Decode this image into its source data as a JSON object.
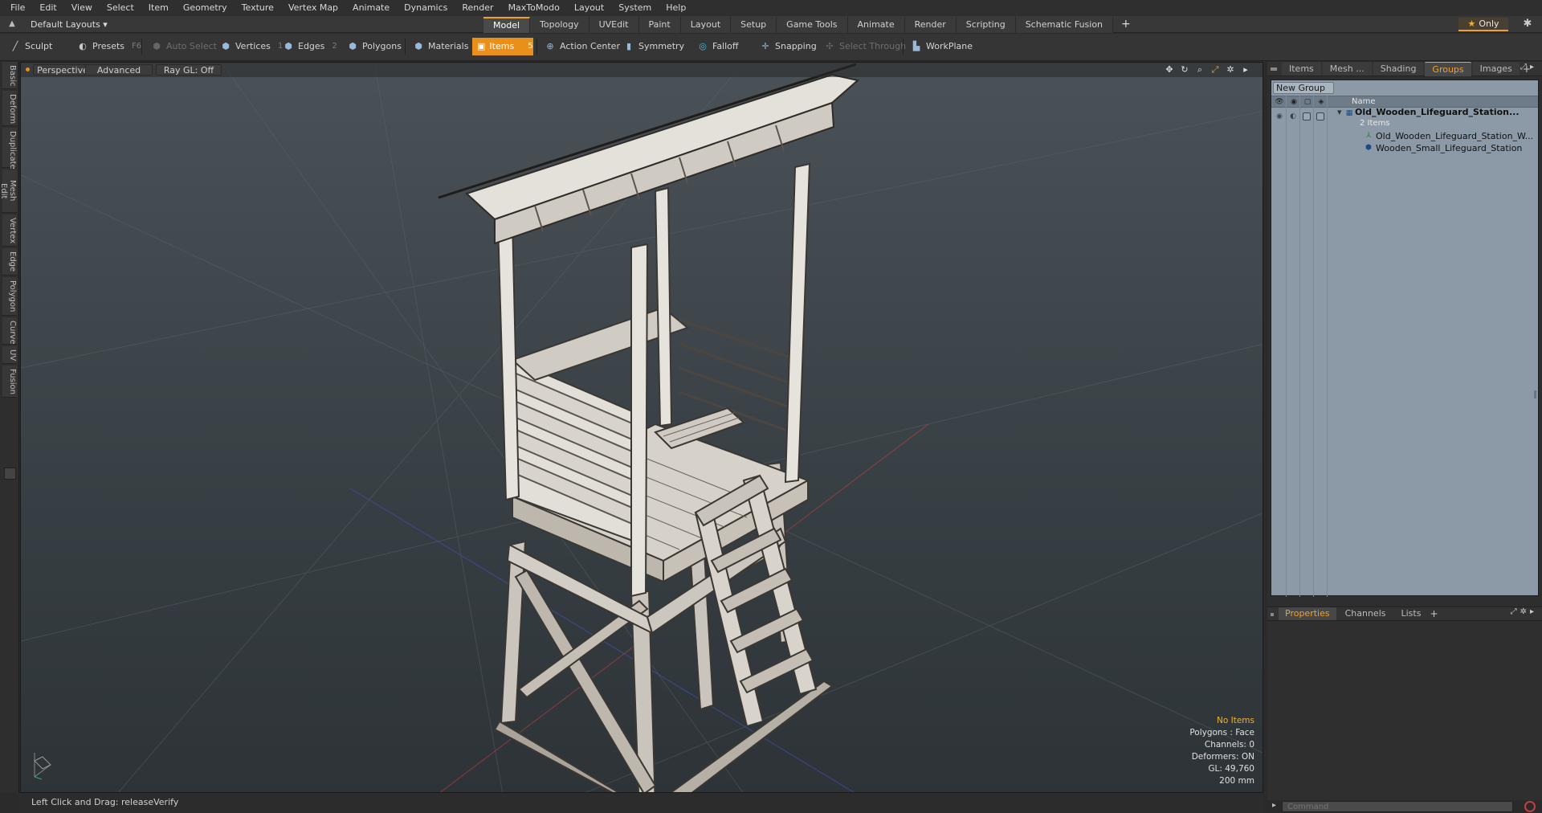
{
  "menubar": [
    "File",
    "Edit",
    "View",
    "Select",
    "Item",
    "Geometry",
    "Texture",
    "Vertex Map",
    "Animate",
    "Dynamics",
    "Render",
    "MaxToModo",
    "Layout",
    "System",
    "Help"
  ],
  "layoutbar": {
    "layouts_label": "Default Layouts ▾",
    "tabs": [
      {
        "label": "Model",
        "active": true
      },
      {
        "label": "Topology",
        "active": false
      },
      {
        "label": "UVEdit",
        "active": false
      },
      {
        "label": "Paint",
        "active": false
      },
      {
        "label": "Layout",
        "active": false
      },
      {
        "label": "Setup",
        "active": false
      },
      {
        "label": "Game Tools",
        "active": false
      },
      {
        "label": "Animate",
        "active": false
      },
      {
        "label": "Render",
        "active": false
      },
      {
        "label": "Scripting",
        "active": false
      },
      {
        "label": "Schematic Fusion",
        "active": false
      }
    ],
    "add_tab": "+",
    "only_label": "Only",
    "only_star": "★",
    "gear": "✱"
  },
  "toolbar": {
    "sculpt": "Sculpt",
    "presets": "Presets",
    "presets_key": "F6",
    "auto_select": "Auto Select",
    "vertices": "Vertices",
    "vertices_key": "1",
    "edges": "Edges",
    "edges_key": "2",
    "polygons": "Polygons",
    "materials": "Materials",
    "items": "Items",
    "items_key": "5",
    "action_center": "Action Center",
    "symmetry": "Symmetry",
    "falloff": "Falloff",
    "snapping": "Snapping",
    "select_through": "Select Through",
    "workplane": "WorkPlane"
  },
  "lefttabs": [
    "Basic",
    "Deform",
    "Duplicate",
    "Mesh Edit",
    "Vertex",
    "Edge",
    "Polygon",
    "Curve",
    "UV",
    "Fusion"
  ],
  "viewport": {
    "perspective": "Perspective",
    "advanced": "Advanced",
    "raygl": "Ray GL: Off",
    "info": {
      "no_items": "No Items",
      "polygons": "Polygons : Face",
      "channels": "Channels: 0",
      "deformers": "Deformers: ON",
      "gl": "GL: 49,760",
      "scale": "200 mm"
    }
  },
  "status": "Left Click and Drag:   releaseVerify",
  "rightpanel": {
    "tabs": [
      {
        "label": "Items",
        "active": false
      },
      {
        "label": "Mesh ...",
        "active": false
      },
      {
        "label": "Shading",
        "active": false
      },
      {
        "label": "Groups",
        "active": true
      },
      {
        "label": "Images",
        "active": false
      }
    ],
    "add": "+",
    "new_group": "New Group",
    "name_header": "Name",
    "group_name": "Old_Wooden_Lifeguard_Station...",
    "group_count": "2 Items",
    "children": [
      {
        "label": "Old_Wooden_Lifeguard_Station_W...",
        "icon": "locator-icon"
      },
      {
        "label": "Wooden_Small_Lifeguard_Station",
        "icon": "mesh-icon"
      }
    ],
    "props_tabs": [
      {
        "label": "Properties",
        "active": true
      },
      {
        "label": "Channels",
        "active": false
      },
      {
        "label": "Lists",
        "active": false
      }
    ],
    "props_add": "+",
    "command_placeholder": "Command"
  },
  "colors": {
    "accent": "#f0a030",
    "items_active": "#e8901a",
    "groups_bg": "#8b9aa6",
    "viewport_top": "#4a5258",
    "viewport_bottom": "#2d3337"
  }
}
